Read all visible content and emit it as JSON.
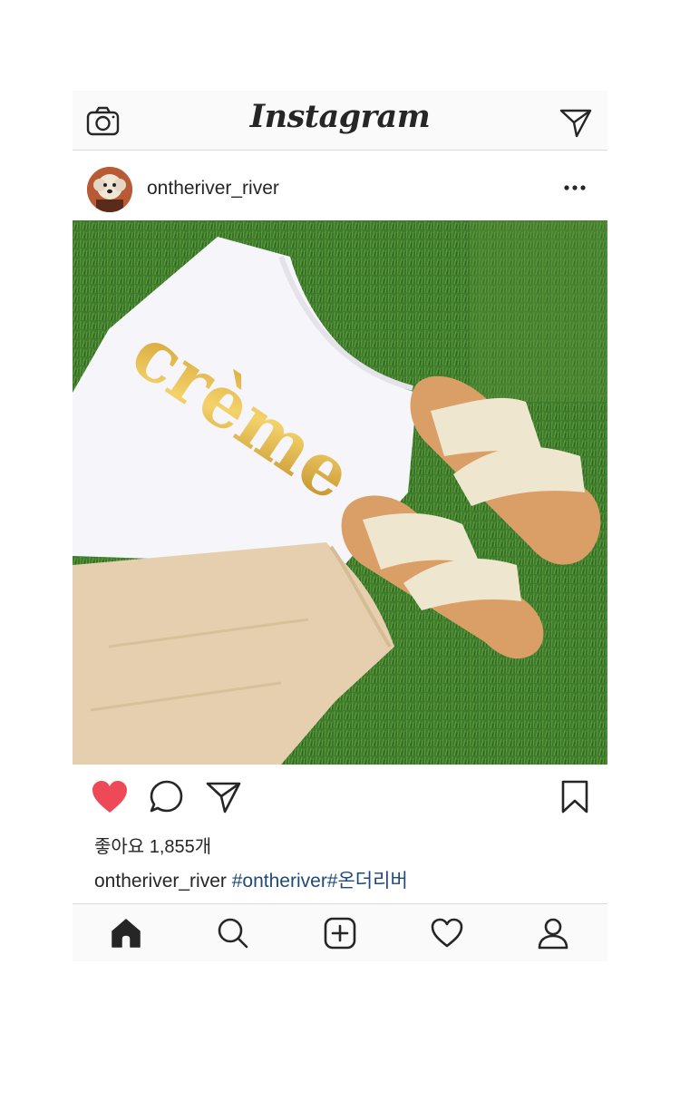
{
  "app": {
    "logo_text": "Instagram",
    "accent_like_color": "#ed4956",
    "hashtag_color": "#1e4a7a"
  },
  "topbar": {
    "left_icon": "camera-icon",
    "right_icon": "direct-message-icon"
  },
  "post": {
    "username": "ontheriver_river",
    "more_icon": "more-options-icon",
    "photo_description_icons": [
      "shirt",
      "sandals",
      "pants",
      "grass"
    ],
    "photo_text": "crème",
    "likes_text": "좋아요 1,855개",
    "caption_username": "ontheriver_river",
    "caption_tags": "#ontheriver#온더리버",
    "liked": true
  },
  "actions": {
    "like_icon": "heart-filled-icon",
    "comment_icon": "comment-icon",
    "share_icon": "share-icon",
    "save_icon": "bookmark-icon"
  },
  "bottom_nav": {
    "items": [
      "home-icon",
      "search-icon",
      "add-post-icon",
      "activity-heart-icon",
      "profile-icon"
    ],
    "active": "home-icon"
  }
}
